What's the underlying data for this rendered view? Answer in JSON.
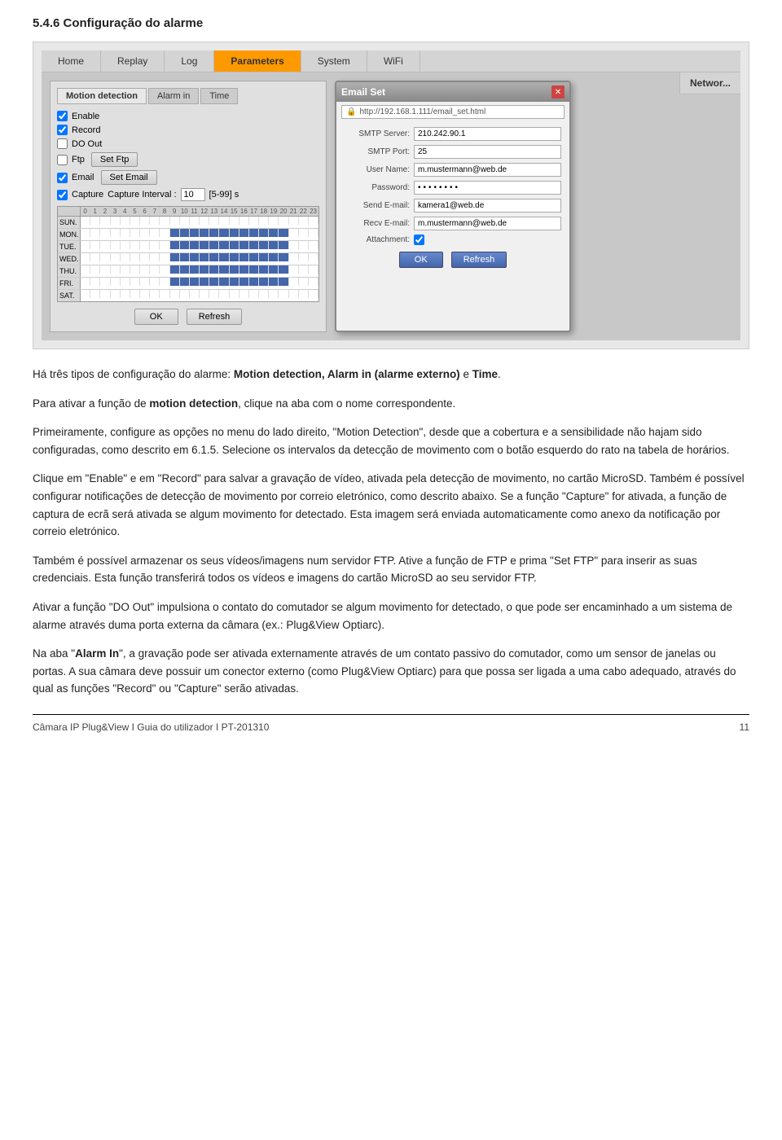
{
  "heading": "5.4.6 Configuração do alarme",
  "nav": {
    "tabs": [
      "Home",
      "Replay",
      "Log",
      "Parameters",
      "System",
      "WiFi"
    ],
    "active": "Parameters"
  },
  "network_partial": "Networ...",
  "panel": {
    "tabs": [
      "Motion detection",
      "Alarm in",
      "Time"
    ],
    "active_tab": "Motion detection",
    "checkboxes": [
      {
        "label": "Enable",
        "checked": true
      },
      {
        "label": "Record",
        "checked": true
      },
      {
        "label": "DO Out",
        "checked": false
      },
      {
        "label": "Ftp",
        "checked": false
      },
      {
        "label": "Email",
        "checked": true
      },
      {
        "label": "Capture",
        "checked": true
      }
    ],
    "set_ftp_btn": "Set Ftp",
    "set_email_btn": "Set Email",
    "capture_label": "Capture Interval :",
    "capture_value": "10",
    "capture_range": "[5-99] s",
    "schedule": {
      "hours": [
        "0",
        "1",
        "2",
        "3",
        "4",
        "5",
        "6",
        "7",
        "8",
        "9",
        "10",
        "11",
        "12",
        "13",
        "14",
        "15",
        "16",
        "17",
        "18",
        "19",
        "20",
        "21",
        "22",
        "23"
      ],
      "days": [
        {
          "label": "SUN.",
          "filled": []
        },
        {
          "label": "MON.",
          "filled": [
            9,
            10,
            11,
            12,
            13,
            14,
            15,
            16,
            17,
            18,
            19,
            20
          ]
        },
        {
          "label": "TUE.",
          "filled": [
            9,
            10,
            11,
            12,
            13,
            14,
            15,
            16,
            17,
            18,
            19,
            20
          ]
        },
        {
          "label": "WED.",
          "filled": [
            9,
            10,
            11,
            12,
            13,
            14,
            15,
            16,
            17,
            18,
            19,
            20
          ]
        },
        {
          "label": "THU.",
          "filled": [
            9,
            10,
            11,
            12,
            13,
            14,
            15,
            16,
            17,
            18,
            19,
            20
          ]
        },
        {
          "label": "FRI.",
          "filled": [
            9,
            10,
            11,
            12,
            13,
            14,
            15,
            16,
            17,
            18,
            19,
            20
          ]
        },
        {
          "label": "SAT.",
          "filled": []
        }
      ]
    },
    "ok_btn": "OK",
    "refresh_btn": "Refresh"
  },
  "email_popup": {
    "title": "Email Set",
    "url": "http://192.168.1.111/email_set.html",
    "fields": [
      {
        "label": "SMTP Server:",
        "value": "210.242.90.1",
        "type": "text"
      },
      {
        "label": "SMTP Port:",
        "value": "25",
        "type": "text"
      },
      {
        "label": "User Name:",
        "value": "m.mustermann@web.de",
        "type": "text"
      },
      {
        "label": "Password:",
        "value": "••••••••",
        "type": "password"
      },
      {
        "label": "Send E-mail:",
        "value": "kamera1@web.de",
        "type": "text"
      },
      {
        "label": "Recv E-mail:",
        "value": "m.mustermann@web.de",
        "type": "text"
      },
      {
        "label": "Attachment:",
        "value": "",
        "type": "checkbox",
        "checked": true
      }
    ],
    "ok_btn": "OK",
    "refresh_btn": "Refresh"
  },
  "paragraphs": [
    "Há três tipos de configuração do alarme: <b>Motion detection, Alarm in (alarme externo)</b> e <b>Time</b>.",
    "Para ativar a função de <b>motion detection</b>, clique na aba com o nome correspondente.",
    "Primeiramente, configure as opções no menu do lado direito, \"Motion Detection\", desde que a cobertura e a sensibilidade não hajam sido configuradas, como descrito em 6.1.5. Selecione os intervalos da detecção de movimento com o botão esquerdo do rato na tabela de horários.",
    "Clique em \"Enable\" e em \"Record\" para salvar a gravação de vídeo, ativada pela detecção de movimento, no cartão MicroSD. Também é possível configurar notificações de detecção de movimento por correio eletrónico, como descrito abaixo. Se a função \"Capture\" for ativada, a função de captura de ecrã será ativada se algum movimento for detectado. Esta imagem será enviada automaticamente como anexo da notificação por correio eletrónico.",
    "Também é possível armazenar os seus vídeos/imagens num servidor FTP. Ative a função de FTP e prima \"Set FTP\" para inserir as suas credenciais. Esta função transferirá todos os vídeos e imagens do cartão MicroSD ao seu servidor FTP.",
    "Ativar a função \"DO Out\" impulsiona o contato do comutador se algum movimento for detectado, o que pode ser encaminhado a um sistema de alarme através duma porta externa da câmara (ex.: Plug&View Optiarc).",
    "Na aba \"<b>Alarm In</b>\", a gravação pode ser ativada externamente através de um contato passivo do comutador, como um sensor de janelas ou portas. A sua câmara deve possuir um conector externo (como Plug&View Optiarc) para que possa ser ligada a uma cabo adequado, através do qual as funções \"Record\" ou \"Capture\" serão ativadas."
  ],
  "footer": {
    "left": "Câmara IP Plug&View I Guia do utilizador I PT-201310",
    "right": "11"
  }
}
